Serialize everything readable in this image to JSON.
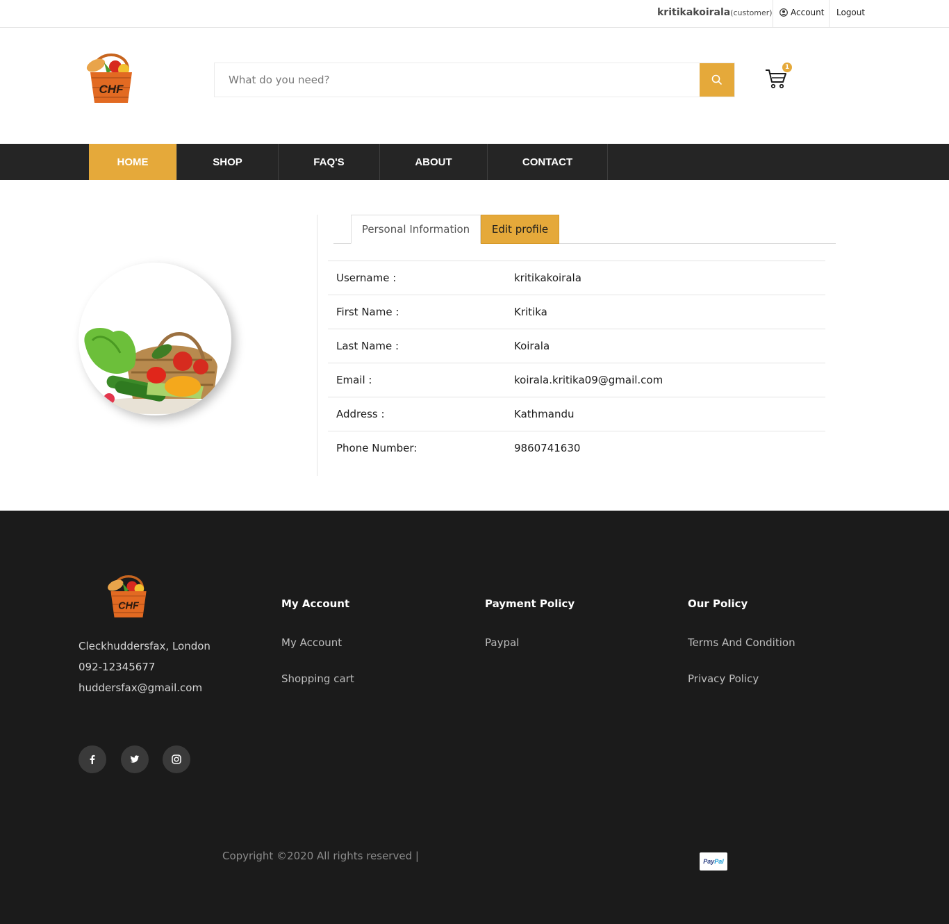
{
  "topbar": {
    "username": "kritikakoirala",
    "role": "(customer)",
    "account_label": "Account",
    "logout_label": "Logout"
  },
  "header": {
    "logo_text": "CHF",
    "search_placeholder": "What do you need?",
    "cart_count": "1"
  },
  "nav": {
    "items": [
      "HOME",
      "SHOP",
      "FAQ'S",
      "ABOUT",
      "CONTACT"
    ],
    "active": "HOME"
  },
  "profile": {
    "tabs": {
      "info": "Personal Information",
      "edit": "Edit profile"
    },
    "rows": [
      {
        "label": "Username :",
        "value": "kritikakoirala"
      },
      {
        "label": "First Name :",
        "value": "Kritika"
      },
      {
        "label": "Last Name :",
        "value": "Koirala"
      },
      {
        "label": "Email :",
        "value": "koirala.kritika09@gmail.com"
      },
      {
        "label": "Address :",
        "value": "Kathmandu"
      },
      {
        "label": "Phone Number:",
        "value": "9860741630"
      }
    ]
  },
  "footer": {
    "logo_text": "CHF",
    "address": "Cleckhuddersfax, London",
    "phone": "092-12345677",
    "email": "huddersfax@gmail.com",
    "columns": [
      {
        "title": "My Account",
        "links": [
          "My Account",
          "Shopping cart"
        ]
      },
      {
        "title": "Payment Policy",
        "links": [
          "Paypal"
        ]
      },
      {
        "title": "Our Policy",
        "links": [
          "Terms And Condition",
          "Privacy Policy"
        ]
      }
    ],
    "social": [
      "facebook-icon",
      "twitter-icon",
      "instagram-icon"
    ],
    "copyright": "Copyright ©2020 All rights reserved |",
    "paypal_part1": "Pay",
    "paypal_part2": "Pal"
  },
  "colors": {
    "accent": "#e5a93a",
    "nav_bg": "#252525",
    "footer_bg": "#1b1b1b"
  }
}
